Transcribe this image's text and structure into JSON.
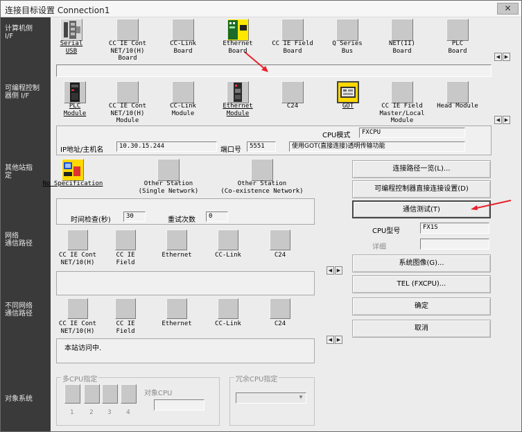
{
  "title": "连接目标设置 Connection1",
  "close_label": "✕",
  "sidebar": {
    "pc_side": "计算机侧\nI/F",
    "plc_side": "可编程控制\n器侧 I/F",
    "other_station": "其他站指\n定",
    "network_route": "网络\n通信路径",
    "diff_network_route": "不同网络\n通信路径",
    "target_system": "对象系统"
  },
  "pc_if": [
    {
      "label": "Serial\nUSB",
      "icon": "serial-usb-icon",
      "underline": true
    },
    {
      "label": "CC IE Cont\nNET/10(H)\nBoard",
      "icon": "blank-icon"
    },
    {
      "label": "CC-Link\nBoard",
      "icon": "blank-icon"
    },
    {
      "label": "Ethernet\nBoard",
      "icon": "ethernet-board-icon"
    },
    {
      "label": "CC IE Field\nBoard",
      "icon": "blank-icon"
    },
    {
      "label": "Q Series\nBus",
      "icon": "blank-icon"
    },
    {
      "label": "NET(II)\nBoard",
      "icon": "blank-icon"
    },
    {
      "label": "PLC\nBoard",
      "icon": "blank-icon"
    }
  ],
  "plc_if": [
    {
      "label": "PLC\nModule",
      "icon": "plc-module-icon",
      "underline": true
    },
    {
      "label": "CC IE Cont\nNET/10(H)\nModule",
      "icon": "blank-icon"
    },
    {
      "label": "CC-Link\nModule",
      "icon": "blank-icon"
    },
    {
      "label": "Ethernet\nModule",
      "icon": "ethernet-module-icon",
      "underline": true
    },
    {
      "label": "C24",
      "icon": "blank-icon"
    },
    {
      "label": "GOT",
      "icon": "got-icon",
      "underline": true
    },
    {
      "label": "CC IE Field\nMaster/Local\nModule",
      "icon": "blank-icon"
    },
    {
      "label": "Head Module",
      "icon": "blank-icon"
    }
  ],
  "plc_detail": {
    "cpu_mode_label": "CPU模式",
    "cpu_mode_value": "FXCPU",
    "ip_label": "IP地址/主机名",
    "ip_value": "10.30.15.244",
    "port_label": "端口号",
    "port_value": "5551",
    "got_transparent": "使用GOT(直接连接)透明传输功能"
  },
  "other_station": [
    {
      "label": "No Specification",
      "icon": "no-spec-icon",
      "underline": true
    },
    {
      "label": "Other Station\n(Single Network)",
      "icon": "blank-icon"
    },
    {
      "label": "Other Station\n(Co-existence Network)",
      "icon": "blank-icon"
    }
  ],
  "timing": {
    "time_check_label": "时间检查(秒)",
    "time_check_value": "30",
    "retry_label": "重试次数",
    "retry_value": "0"
  },
  "network_items": [
    {
      "label": "CC IE Cont\nNET/10(H)"
    },
    {
      "label": "CC IE\nField"
    },
    {
      "label": "Ethernet"
    },
    {
      "label": "CC-Link"
    },
    {
      "label": "C24"
    }
  ],
  "diff_network_items": [
    {
      "label": "CC IE Cont\nNET/10(H)"
    },
    {
      "label": "CC IE\nField"
    },
    {
      "label": "Ethernet"
    },
    {
      "label": "CC-Link"
    },
    {
      "label": "C24"
    }
  ],
  "diff_network_text": "本站访问中.",
  "right": {
    "route_list": "连接路径一览(L)...",
    "direct_setting": "可编程控制器直接连接设置(D)",
    "comm_test": "通信测试(T)",
    "cpu_type_label": "CPU型号",
    "cpu_type_value": "FX1S",
    "detail_label": "详细",
    "system_image": "系统图像(G)...",
    "tel": "TEL (FXCPU)...",
    "ok": "确定",
    "cancel": "取消"
  },
  "multi_cpu": {
    "legend": "多CPU指定",
    "target_cpu": "对象CPU",
    "nums": [
      "1",
      "2",
      "3",
      "4"
    ]
  },
  "redundant": {
    "legend": "冗余CPU指定"
  },
  "colors": {
    "sidebar": "#3a3a3a",
    "arrow": "#e8202a",
    "got_highlight": "#ffd800"
  }
}
